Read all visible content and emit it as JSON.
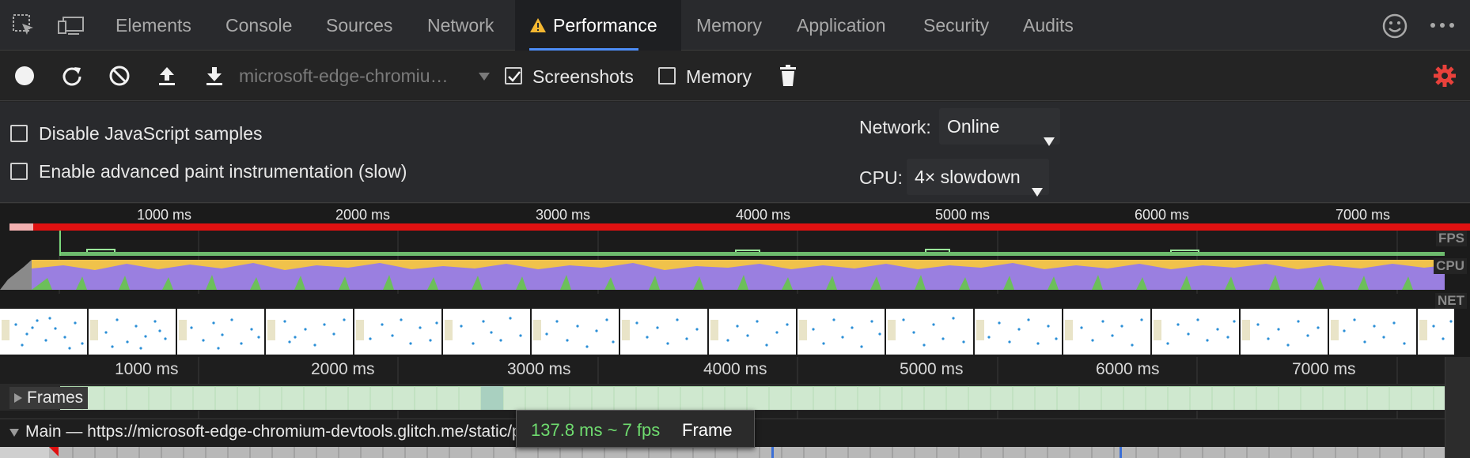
{
  "tabbar": {
    "tabs": [
      {
        "label": "Elements"
      },
      {
        "label": "Console"
      },
      {
        "label": "Sources"
      },
      {
        "label": "Network"
      },
      {
        "label": "Performance",
        "active": true,
        "warning": true
      },
      {
        "label": "Memory"
      },
      {
        "label": "Application"
      },
      {
        "label": "Security"
      },
      {
        "label": "Audits"
      }
    ],
    "icons": [
      "inspect-element-icon",
      "device-toolbar-icon",
      "feedback-smiley-icon",
      "more-options-icon"
    ]
  },
  "toolbar": {
    "profile_select": "microsoft-edge-chromiu…",
    "screenshots_label": "Screenshots",
    "screenshots_checked": true,
    "memory_label": "Memory",
    "memory_checked": false,
    "icons": [
      "record-icon",
      "reload-icon",
      "clear-icon",
      "upload-icon",
      "download-icon",
      "delete-icon",
      "settings-gear-icon"
    ],
    "settings_accent": "#e8413b"
  },
  "settings": {
    "disable_js_samples": "Disable JavaScript samples",
    "advanced_paint": "Enable advanced paint instrumentation (slow)",
    "network_label": "Network:",
    "network_value": "Online",
    "cpu_label": "CPU:",
    "cpu_value": "4× slowdown"
  },
  "overview": {
    "ruler": [
      "1000 ms",
      "2000 ms",
      "3000 ms",
      "4000 ms",
      "5000 ms",
      "6000 ms",
      "7000 ms"
    ],
    "lanes": [
      "FPS",
      "CPU",
      "NET"
    ],
    "colors": {
      "long_frames": "#e01111",
      "fps": "#7bd77b",
      "scripting": "#f0c24b",
      "rendering": "#9a7fe0",
      "painting": "#6cbf5a"
    }
  },
  "timeline": {
    "ruler": [
      "1000 ms",
      "2000 ms",
      "3000 ms",
      "4000 ms",
      "5000 ms",
      "6000 ms",
      "7000 ms"
    ],
    "frames_label": "Frames",
    "main_label": "Main — https://microsoft-edge-chromium-devtools.glitch.me/static/perf/get-started/"
  },
  "tooltip": {
    "fps": "137.8 ms ~ 7 fps",
    "label": "Frame"
  }
}
